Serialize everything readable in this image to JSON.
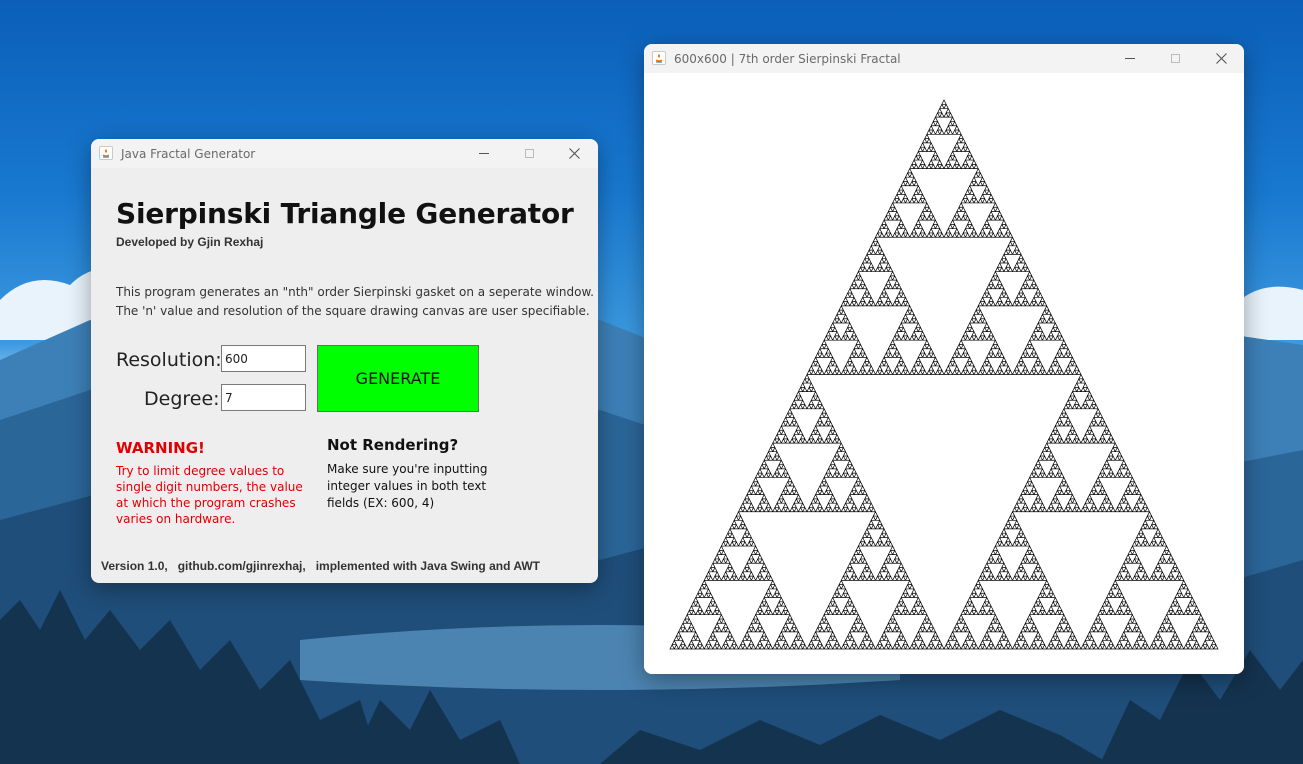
{
  "generator_window": {
    "title": "Java Fractal Generator",
    "heading": "Sierpinski Triangle Generator",
    "subheading": "Developed by Gjin Rexhaj",
    "description": [
      "This program generates an \"nth\" order Sierpinski gasket on a seperate window.",
      "The 'n' value and resolution of the square drawing canvas are user specifiable."
    ],
    "resolution_label": "Resolution:",
    "resolution_value": "600",
    "degree_label": "Degree:",
    "degree_value": "7",
    "generate_label": "GENERATE",
    "generate_color": "#00ff00",
    "warning_title": "WARNING!",
    "warning_lines": [
      "Try to limit degree values to",
      "single digit numbers, the value",
      "at which the program crashes",
      "varies on hardware."
    ],
    "warning_color": "#e00000",
    "not_rendering_title": "Not Rendering?",
    "not_rendering_lines": [
      "Make sure you're inputting",
      "integer values in both text",
      "fields (EX: 600, 4)"
    ],
    "footer": "Version 1.0,   github.com/gjinrexhaj,   implemented with Java Swing and AWT"
  },
  "fractal_window": {
    "title": "600x600 | 7th order Sierpinski Fractal",
    "order": 7
  },
  "window_controls": {
    "minimize_icon": "minimize-icon",
    "maximize_icon": "maximize-icon",
    "close_icon": "close-icon",
    "app_icon": "java-icon"
  }
}
